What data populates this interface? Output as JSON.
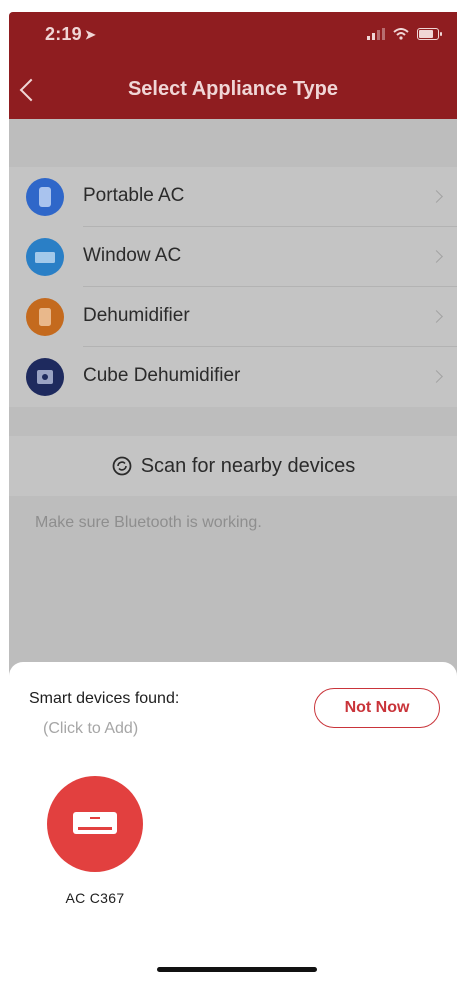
{
  "status_bar": {
    "time": "2:19"
  },
  "header": {
    "title": "Select Appliance Type"
  },
  "appliances": [
    {
      "label": "Portable AC",
      "icon": "portable-ac-icon",
      "color": "#2f67c9"
    },
    {
      "label": "Window AC",
      "icon": "window-ac-icon",
      "color": "#2a7fc6"
    },
    {
      "label": "Dehumidifier",
      "icon": "dehumidifier-icon",
      "color": "#c46a1e"
    },
    {
      "label": "Cube Dehumidifier",
      "icon": "cube-dehumidifier-icon",
      "color": "#1e2a5e"
    }
  ],
  "scan": {
    "label": "Scan for nearby devices",
    "hint": "Make sure Bluetooth is working."
  },
  "sheet": {
    "title": "Smart devices found:",
    "subtitle": "(Click to Add)",
    "dismiss_label": "Not Now",
    "devices": [
      {
        "label": "AC C367",
        "icon": "air-conditioner-icon",
        "color": "#e2403f"
      }
    ]
  },
  "colors": {
    "brand": "#8f1d20",
    "accent": "#c9343a"
  }
}
